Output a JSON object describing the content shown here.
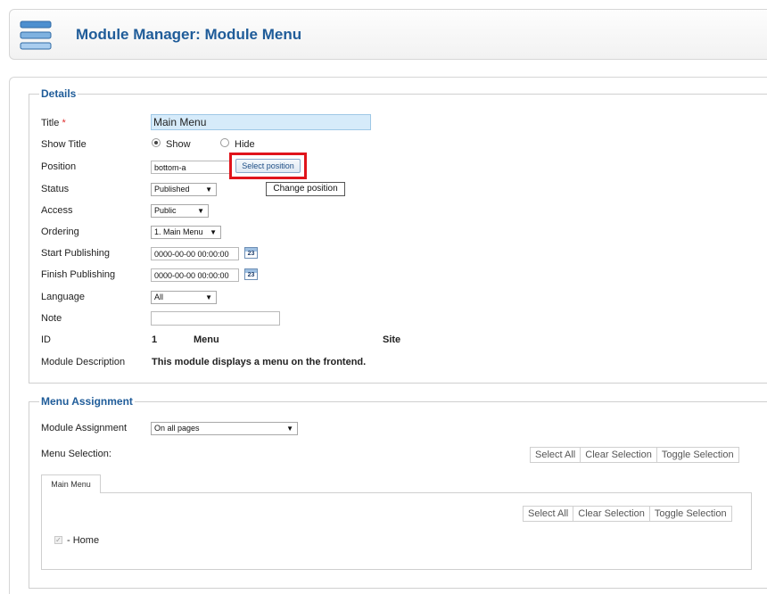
{
  "header": {
    "title": "Module Manager: Module Menu",
    "icon": "menu-module-icon"
  },
  "details": {
    "legend": "Details",
    "title_label": "Title",
    "required_mark": "*",
    "title_value": "Main Menu",
    "show_title_label": "Show Title",
    "show_option": "Show",
    "hide_option": "Hide",
    "show_title_selected": "Show",
    "position_label": "Position",
    "position_value": "bottom-a",
    "select_position_button": "Select position",
    "tooltip": "Change position",
    "status_label": "Status",
    "status_value": "Published",
    "access_label": "Access",
    "access_value": "Public",
    "ordering_label": "Ordering",
    "ordering_value": "1. Main Menu",
    "start_publishing_label": "Start Publishing",
    "start_publishing_value": "0000-00-00 00:00:00",
    "finish_publishing_label": "Finish Publishing",
    "finish_publishing_value": "0000-00-00 00:00:00",
    "calendar_day": "23",
    "language_label": "Language",
    "language_value": "All",
    "note_label": "Note",
    "note_value": "",
    "id_label": "ID",
    "id_value": "1",
    "id_type": "Menu",
    "id_client": "Site",
    "description_label": "Module Description",
    "description_value": "This module displays a menu on the frontend."
  },
  "menu_assignment": {
    "legend": "Menu Assignment",
    "module_assignment_label": "Module Assignment",
    "module_assignment_value": "On all pages",
    "menu_selection_label": "Menu Selection:",
    "select_all": "Select All",
    "clear_selection": "Clear Selection",
    "toggle_selection": "Toggle Selection",
    "tab_label": "Main Menu",
    "item_home": "- Home",
    "item_home_checked": true
  },
  "colors": {
    "accent": "#1f5c99",
    "highlight": "#e0141b",
    "title_field_bg": "#d6ebfa"
  }
}
